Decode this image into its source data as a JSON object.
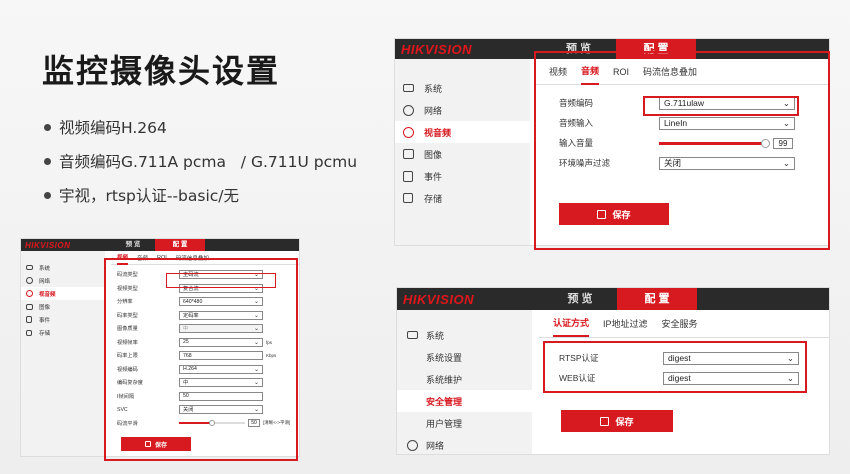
{
  "slide": {
    "title": "监控摄像头设置",
    "bullets": [
      "视频编码H.264",
      "音频编码G.711A pcma   / G.711U pcmu",
      "宇视，rtsp认证--basic/无"
    ]
  },
  "audio_shot": {
    "logo": "HIKVISION",
    "top_tabs": [
      "预 览",
      "配 置"
    ],
    "side_items": [
      {
        "label": "系统",
        "icon": "monitor-icon"
      },
      {
        "label": "网络",
        "icon": "globe-icon"
      },
      {
        "label": "视音频",
        "icon": "video-audio-icon"
      },
      {
        "label": "图像",
        "icon": "image-icon"
      },
      {
        "label": "事件",
        "icon": "event-icon"
      },
      {
        "label": "存储",
        "icon": "storage-icon"
      }
    ],
    "tabs": [
      "视频",
      "音频",
      "ROI",
      "码流信息叠加"
    ],
    "fields": [
      {
        "label": "音频编码",
        "value": "G.711ulaw"
      },
      {
        "label": "音频输入",
        "value": "LineIn"
      },
      {
        "label": "输入音量",
        "value": "99"
      },
      {
        "label": "环境噪声过滤",
        "value": "关闭"
      }
    ],
    "volume_fraction": 0.99,
    "save": "保存"
  },
  "video_shot": {
    "logo": "HIKVISION",
    "top_tabs": [
      "预 览",
      "配 置"
    ],
    "side_items": [
      {
        "label": "系统",
        "icon": "monitor-icon"
      },
      {
        "label": "网络",
        "icon": "globe-icon"
      },
      {
        "label": "视音频",
        "icon": "video-audio-icon"
      },
      {
        "label": "图像",
        "icon": "image-icon"
      },
      {
        "label": "事件",
        "icon": "event-icon"
      },
      {
        "label": "存储",
        "icon": "storage-icon"
      }
    ],
    "tabs": [
      "视频",
      "音频",
      "ROI",
      "码流信息叠加"
    ],
    "fields": [
      {
        "label": "码流类型",
        "value": "主码流",
        "kind": "select"
      },
      {
        "label": "视频类型",
        "value": "复合流",
        "kind": "select"
      },
      {
        "label": "分辨率",
        "value": "640*480",
        "kind": "select"
      },
      {
        "label": "码率类型",
        "value": "定码率",
        "kind": "select"
      },
      {
        "label": "图像质量",
        "value": "中",
        "kind": "select"
      },
      {
        "label": "视频帧率",
        "value": "25",
        "kind": "select",
        "unit": "fps"
      },
      {
        "label": "码率上限",
        "value": "768",
        "kind": "input",
        "unit": "Kbps"
      },
      {
        "label": "视频编码",
        "value": "H.264",
        "kind": "select"
      },
      {
        "label": "编码复杂度",
        "value": "中",
        "kind": "select"
      },
      {
        "label": "I帧间隔",
        "value": "50",
        "kind": "input"
      },
      {
        "label": "SVC",
        "value": "关闭",
        "kind": "select"
      },
      {
        "label": "码流平滑",
        "value": "50",
        "kind": "slider",
        "unit": "[清晰<->平滑]"
      }
    ],
    "smoothing_fraction": 0.5,
    "save": "保存"
  },
  "security_shot": {
    "logo": "HIKVISION",
    "top_tabs": [
      "预 览",
      "配 置"
    ],
    "side_items": [
      {
        "label": "系统",
        "icon": "monitor-icon",
        "level": 0
      },
      {
        "label": "系统设置",
        "level": 1
      },
      {
        "label": "系统维护",
        "level": 1
      },
      {
        "label": "安全管理",
        "level": 1,
        "active": true
      },
      {
        "label": "用户管理",
        "level": 1
      },
      {
        "label": "网络",
        "icon": "globe-icon",
        "level": 0
      }
    ],
    "tabs": [
      "认证方式",
      "IP地址过滤",
      "安全服务"
    ],
    "fields": [
      {
        "label": "RTSP认证",
        "value": "digest"
      },
      {
        "label": "WEB认证",
        "value": "digest"
      }
    ],
    "save": "保存"
  }
}
